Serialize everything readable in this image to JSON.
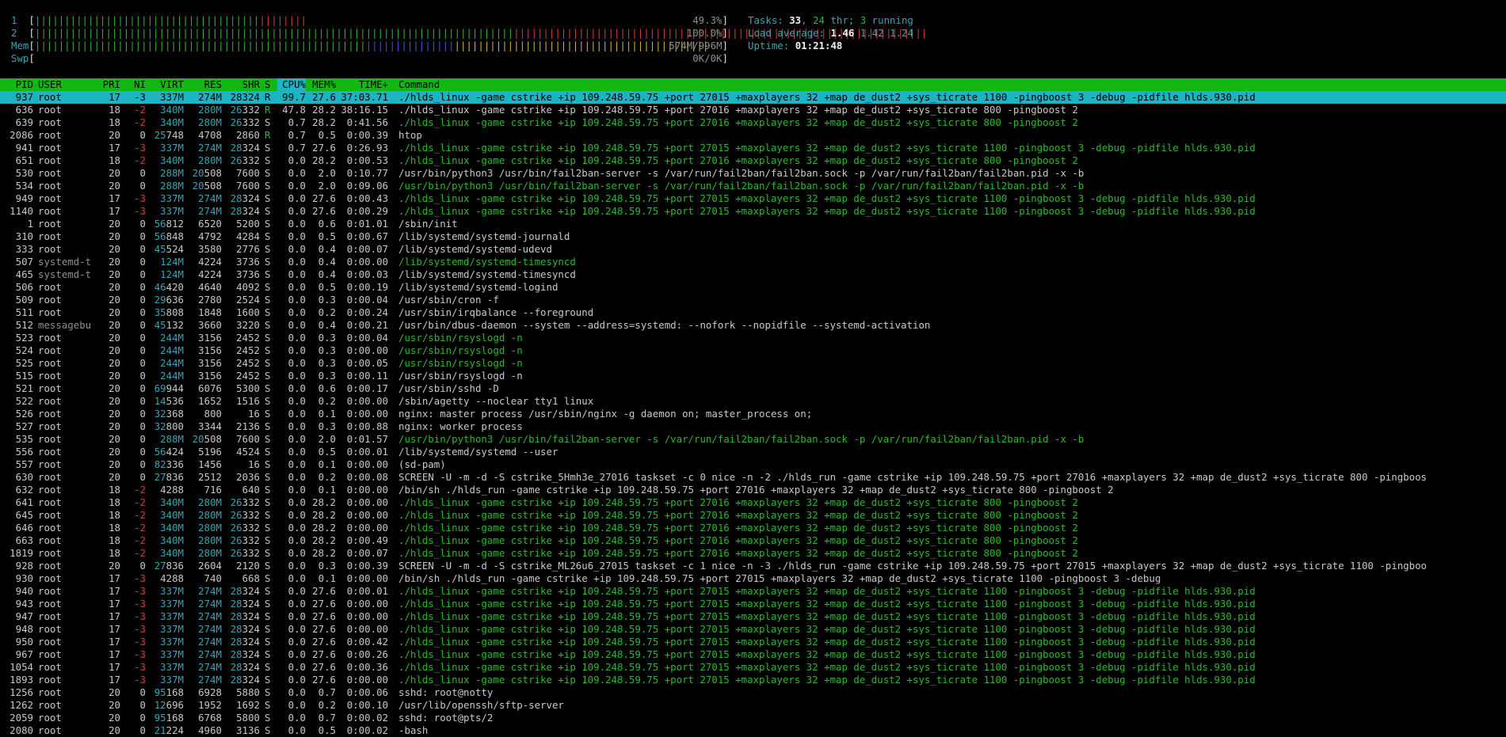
{
  "meters": [
    {
      "label": "1",
      "green": "||||||||||||||||||||||||||||||||||||||",
      "red": "||||||||",
      "blue": "",
      "yellow": "",
      "value": "49.3%"
    },
    {
      "label": "2",
      "green": "|||||||||||||||||||||||||||||||||||||||||||||||||||||||||||||||||||||||||||||||||",
      "red": "||||||||||||||||||||||||||||||||||||||||||||||||||||||||||||||||||||||",
      "blue": "",
      "yellow": "",
      "value": "100.0%"
    },
    {
      "label": "Mem",
      "green": "||||||||||||||||||||||||||||||||||||||||||||||||||||||||",
      "red": "",
      "blue": "|||||||||||||||",
      "yellow": "|||||||||||||||||||||||||||||||||||||||||||",
      "value": "574M/996M"
    },
    {
      "label": "Swp",
      "green": "",
      "red": "",
      "blue": "",
      "yellow": "",
      "value": "0K/0K"
    }
  ],
  "tasks": {
    "label": "Tasks: ",
    "total": "33",
    "sep": ", ",
    "thr": "24",
    "thr_label": " thr; ",
    "running": "3",
    "running_label": " running"
  },
  "load": {
    "label": "Load average: ",
    "l1": "1.46",
    "l5": "1.42",
    "l15": "1.24"
  },
  "uptime": {
    "label": "Uptime: ",
    "value": "01:21:48"
  },
  "columns": [
    "PID",
    "USER",
    "PRI",
    "NI",
    "VIRT",
    "RES",
    "SHR",
    "S",
    "CPU%",
    "MEM%",
    "TIME+",
    "Command"
  ],
  "rows": [
    {
      "pid": "937",
      "user": "root",
      "pri": "17",
      "ni": "-3",
      "virt": "337M",
      "res": "274M",
      "shr": "28324",
      "s": "R",
      "cpu": "99.7",
      "mem": "27.6",
      "time": "37:03.71",
      "cmd": "./hlds_linux -game cstrike +ip 109.248.59.75 +port 27015 +maxplayers 32 +map de_dust2 +sys_ticrate 1100 -pingboost 3 -debug -pidfile hlds.930.pid",
      "selected": true
    },
    {
      "pid": "636",
      "user": "root",
      "pri": "18",
      "ni": "-2",
      "virt": "340M",
      "res": "280M",
      "shr": "26332",
      "s": "R",
      "cpu": "47.8",
      "mem": "28.2",
      "time": "38:16.15",
      "cmd": "./hlds_linux -game cstrike +ip 109.248.59.75 +port 27016 +maxplayers 32 +map de_dust2 +sys_ticrate 800 -pingboost 2"
    },
    {
      "pid": "639",
      "user": "root",
      "pri": "18",
      "ni": "-2",
      "virt": "340M",
      "res": "280M",
      "shr": "26332",
      "s": "S",
      "cpu": "0.7",
      "mem": "28.2",
      "time": "0:41.56",
      "cmd": "./hlds_linux -game cstrike +ip 109.248.59.75 +port 27016 +maxplayers 32 +map de_dust2 +sys_ticrate 800 -pingboost 2",
      "thread": true
    },
    {
      "pid": "2086",
      "user": "root",
      "pri": "20",
      "ni": "0",
      "virt": "25748",
      "res": "4708",
      "shr": "2860",
      "s": "R",
      "cpu": "0.7",
      "mem": "0.5",
      "time": "0:00.39",
      "cmd": "htop"
    },
    {
      "pid": "941",
      "user": "root",
      "pri": "17",
      "ni": "-3",
      "virt": "337M",
      "res": "274M",
      "shr": "28324",
      "s": "S",
      "cpu": "0.7",
      "mem": "27.6",
      "time": "0:26.93",
      "cmd": "./hlds_linux -game cstrike +ip 109.248.59.75 +port 27015 +maxplayers 32 +map de_dust2 +sys_ticrate 1100 -pingboost 3 -debug -pidfile hlds.930.pid",
      "thread": true
    },
    {
      "pid": "651",
      "user": "root",
      "pri": "18",
      "ni": "-2",
      "virt": "340M",
      "res": "280M",
      "shr": "26332",
      "s": "S",
      "cpu": "0.0",
      "mem": "28.2",
      "time": "0:00.53",
      "cmd": "./hlds_linux -game cstrike +ip 109.248.59.75 +port 27016 +maxplayers 32 +map de_dust2 +sys_ticrate 800 -pingboost 2",
      "thread": true
    },
    {
      "pid": "530",
      "user": "root",
      "pri": "20",
      "ni": "0",
      "virt": "288M",
      "res": "20508",
      "shr": "7600",
      "s": "S",
      "cpu": "0.0",
      "mem": "2.0",
      "time": "0:10.77",
      "cmd": "/usr/bin/python3 /usr/bin/fail2ban-server -s /var/run/fail2ban/fail2ban.sock -p /var/run/fail2ban/fail2ban.pid -x -b"
    },
    {
      "pid": "534",
      "user": "root",
      "pri": "20",
      "ni": "0",
      "virt": "288M",
      "res": "20508",
      "shr": "7600",
      "s": "S",
      "cpu": "0.0",
      "mem": "2.0",
      "time": "0:09.06",
      "cmd": "/usr/bin/python3 /usr/bin/fail2ban-server -s /var/run/fail2ban/fail2ban.sock -p /var/run/fail2ban/fail2ban.pid -x -b",
      "thread": true
    },
    {
      "pid": "949",
      "user": "root",
      "pri": "17",
      "ni": "-3",
      "virt": "337M",
      "res": "274M",
      "shr": "28324",
      "s": "S",
      "cpu": "0.0",
      "mem": "27.6",
      "time": "0:00.43",
      "cmd": "./hlds_linux -game cstrike +ip 109.248.59.75 +port 27015 +maxplayers 32 +map de_dust2 +sys_ticrate 1100 -pingboost 3 -debug -pidfile hlds.930.pid",
      "thread": true
    },
    {
      "pid": "1140",
      "user": "root",
      "pri": "17",
      "ni": "-3",
      "virt": "337M",
      "res": "274M",
      "shr": "28324",
      "s": "S",
      "cpu": "0.0",
      "mem": "27.6",
      "time": "0:00.29",
      "cmd": "./hlds_linux -game cstrike +ip 109.248.59.75 +port 27015 +maxplayers 32 +map de_dust2 +sys_ticrate 1100 -pingboost 3 -debug -pidfile hlds.930.pid",
      "thread": true
    },
    {
      "pid": "1",
      "user": "root",
      "pri": "20",
      "ni": "0",
      "virt": "56812",
      "res": "6520",
      "shr": "5200",
      "s": "S",
      "cpu": "0.0",
      "mem": "0.6",
      "time": "0:01.01",
      "cmd": "/sbin/init"
    },
    {
      "pid": "310",
      "user": "root",
      "pri": "20",
      "ni": "0",
      "virt": "56848",
      "res": "4792",
      "shr": "4284",
      "s": "S",
      "cpu": "0.0",
      "mem": "0.5",
      "time": "0:00.67",
      "cmd": "/lib/systemd/systemd-journald"
    },
    {
      "pid": "333",
      "user": "root",
      "pri": "20",
      "ni": "0",
      "virt": "45524",
      "res": "3580",
      "shr": "2776",
      "s": "S",
      "cpu": "0.0",
      "mem": "0.4",
      "time": "0:00.07",
      "cmd": "/lib/systemd/systemd-udevd"
    },
    {
      "pid": "507",
      "user": "systemd-t",
      "pri": "20",
      "ni": "0",
      "virt": "124M",
      "res": "4224",
      "shr": "3736",
      "s": "S",
      "cpu": "0.0",
      "mem": "0.4",
      "time": "0:00.00",
      "cmd": "/lib/systemd/systemd-timesyncd",
      "thread": true,
      "dimuser": true
    },
    {
      "pid": "465",
      "user": "systemd-t",
      "pri": "20",
      "ni": "0",
      "virt": "124M",
      "res": "4224",
      "shr": "3736",
      "s": "S",
      "cpu": "0.0",
      "mem": "0.4",
      "time": "0:00.03",
      "cmd": "/lib/systemd/systemd-timesyncd",
      "dimuser": true
    },
    {
      "pid": "506",
      "user": "root",
      "pri": "20",
      "ni": "0",
      "virt": "46420",
      "res": "4640",
      "shr": "4092",
      "s": "S",
      "cpu": "0.0",
      "mem": "0.5",
      "time": "0:00.19",
      "cmd": "/lib/systemd/systemd-logind"
    },
    {
      "pid": "509",
      "user": "root",
      "pri": "20",
      "ni": "0",
      "virt": "29636",
      "res": "2780",
      "shr": "2524",
      "s": "S",
      "cpu": "0.0",
      "mem": "0.3",
      "time": "0:00.04",
      "cmd": "/usr/sbin/cron -f"
    },
    {
      "pid": "511",
      "user": "root",
      "pri": "20",
      "ni": "0",
      "virt": "35808",
      "res": "1848",
      "shr": "1600",
      "s": "S",
      "cpu": "0.0",
      "mem": "0.2",
      "time": "0:00.24",
      "cmd": "/usr/sbin/irqbalance --foreground"
    },
    {
      "pid": "512",
      "user": "messagebu",
      "pri": "20",
      "ni": "0",
      "virt": "45132",
      "res": "3660",
      "shr": "3220",
      "s": "S",
      "cpu": "0.0",
      "mem": "0.4",
      "time": "0:00.21",
      "cmd": "/usr/bin/dbus-daemon --system --address=systemd: --nofork --nopidfile --systemd-activation",
      "dimuser": true
    },
    {
      "pid": "523",
      "user": "root",
      "pri": "20",
      "ni": "0",
      "virt": "244M",
      "res": "3156",
      "shr": "2452",
      "s": "S",
      "cpu": "0.0",
      "mem": "0.3",
      "time": "0:00.04",
      "cmd": "/usr/sbin/rsyslogd -n",
      "thread": true
    },
    {
      "pid": "524",
      "user": "root",
      "pri": "20",
      "ni": "0",
      "virt": "244M",
      "res": "3156",
      "shr": "2452",
      "s": "S",
      "cpu": "0.0",
      "mem": "0.3",
      "time": "0:00.00",
      "cmd": "/usr/sbin/rsyslogd -n",
      "thread": true
    },
    {
      "pid": "525",
      "user": "root",
      "pri": "20",
      "ni": "0",
      "virt": "244M",
      "res": "3156",
      "shr": "2452",
      "s": "S",
      "cpu": "0.0",
      "mem": "0.3",
      "time": "0:00.05",
      "cmd": "/usr/sbin/rsyslogd -n",
      "thread": true
    },
    {
      "pid": "515",
      "user": "root",
      "pri": "20",
      "ni": "0",
      "virt": "244M",
      "res": "3156",
      "shr": "2452",
      "s": "S",
      "cpu": "0.0",
      "mem": "0.3",
      "time": "0:00.11",
      "cmd": "/usr/sbin/rsyslogd -n"
    },
    {
      "pid": "521",
      "user": "root",
      "pri": "20",
      "ni": "0",
      "virt": "69944",
      "res": "6076",
      "shr": "5300",
      "s": "S",
      "cpu": "0.0",
      "mem": "0.6",
      "time": "0:00.17",
      "cmd": "/usr/sbin/sshd -D"
    },
    {
      "pid": "522",
      "user": "root",
      "pri": "20",
      "ni": "0",
      "virt": "14536",
      "res": "1652",
      "shr": "1516",
      "s": "S",
      "cpu": "0.0",
      "mem": "0.2",
      "time": "0:00.00",
      "cmd": "/sbin/agetty --noclear tty1 linux"
    },
    {
      "pid": "526",
      "user": "root",
      "pri": "20",
      "ni": "0",
      "virt": "32368",
      "res": "800",
      "shr": "16",
      "s": "S",
      "cpu": "0.0",
      "mem": "0.1",
      "time": "0:00.00",
      "cmd": "nginx: master process /usr/sbin/nginx -g daemon on; master_process on;"
    },
    {
      "pid": "527",
      "user": "root",
      "pri": "20",
      "ni": "0",
      "virt": "32800",
      "res": "3344",
      "shr": "2136",
      "s": "S",
      "cpu": "0.0",
      "mem": "0.3",
      "time": "0:00.88",
      "cmd": "nginx: worker process"
    },
    {
      "pid": "535",
      "user": "root",
      "pri": "20",
      "ni": "0",
      "virt": "288M",
      "res": "20508",
      "shr": "7600",
      "s": "S",
      "cpu": "0.0",
      "mem": "2.0",
      "time": "0:01.57",
      "cmd": "/usr/bin/python3 /usr/bin/fail2ban-server -s /var/run/fail2ban/fail2ban.sock -p /var/run/fail2ban/fail2ban.pid -x -b",
      "thread": true
    },
    {
      "pid": "556",
      "user": "root",
      "pri": "20",
      "ni": "0",
      "virt": "56424",
      "res": "5196",
      "shr": "4524",
      "s": "S",
      "cpu": "0.0",
      "mem": "0.5",
      "time": "0:00.01",
      "cmd": "/lib/systemd/systemd --user"
    },
    {
      "pid": "557",
      "user": "root",
      "pri": "20",
      "ni": "0",
      "virt": "82336",
      "res": "1456",
      "shr": "16",
      "s": "S",
      "cpu": "0.0",
      "mem": "0.1",
      "time": "0:00.00",
      "cmd": "(sd-pam)"
    },
    {
      "pid": "630",
      "user": "root",
      "pri": "20",
      "ni": "0",
      "virt": "27836",
      "res": "2512",
      "shr": "2036",
      "s": "S",
      "cpu": "0.0",
      "mem": "0.2",
      "time": "0:00.08",
      "cmd": "SCREEN -U -m -d -S cstrike_5Hmh3e_27016 taskset -c 0 nice -n -2 ./hlds_run -game cstrike +ip 109.248.59.75 +port 27016 +maxplayers 32 +map de_dust2 +sys_ticrate 800 -pingboos"
    },
    {
      "pid": "632",
      "user": "root",
      "pri": "18",
      "ni": "-2",
      "virt": "4288",
      "res": "716",
      "shr": "640",
      "s": "S",
      "cpu": "0.0",
      "mem": "0.1",
      "time": "0:00.00",
      "cmd": "/bin/sh ./hlds_run -game cstrike +ip 109.248.59.75 +port 27016 +maxplayers 32 +map de_dust2 +sys_ticrate 800 -pingboost 2"
    },
    {
      "pid": "641",
      "user": "root",
      "pri": "18",
      "ni": "-2",
      "virt": "340M",
      "res": "280M",
      "shr": "26332",
      "s": "S",
      "cpu": "0.0",
      "mem": "28.2",
      "time": "0:00.00",
      "cmd": "./hlds_linux -game cstrike +ip 109.248.59.75 +port 27016 +maxplayers 32 +map de_dust2 +sys_ticrate 800 -pingboost 2",
      "thread": true
    },
    {
      "pid": "645",
      "user": "root",
      "pri": "18",
      "ni": "-2",
      "virt": "340M",
      "res": "280M",
      "shr": "26332",
      "s": "S",
      "cpu": "0.0",
      "mem": "28.2",
      "time": "0:00.00",
      "cmd": "./hlds_linux -game cstrike +ip 109.248.59.75 +port 27016 +maxplayers 32 +map de_dust2 +sys_ticrate 800 -pingboost 2",
      "thread": true
    },
    {
      "pid": "646",
      "user": "root",
      "pri": "18",
      "ni": "-2",
      "virt": "340M",
      "res": "280M",
      "shr": "26332",
      "s": "S",
      "cpu": "0.0",
      "mem": "28.2",
      "time": "0:00.00",
      "cmd": "./hlds_linux -game cstrike +ip 109.248.59.75 +port 27016 +maxplayers 32 +map de_dust2 +sys_ticrate 800 -pingboost 2",
      "thread": true
    },
    {
      "pid": "663",
      "user": "root",
      "pri": "18",
      "ni": "-2",
      "virt": "340M",
      "res": "280M",
      "shr": "26332",
      "s": "S",
      "cpu": "0.0",
      "mem": "28.2",
      "time": "0:00.49",
      "cmd": "./hlds_linux -game cstrike +ip 109.248.59.75 +port 27016 +maxplayers 32 +map de_dust2 +sys_ticrate 800 -pingboost 2",
      "thread": true
    },
    {
      "pid": "1819",
      "user": "root",
      "pri": "18",
      "ni": "-2",
      "virt": "340M",
      "res": "280M",
      "shr": "26332",
      "s": "S",
      "cpu": "0.0",
      "mem": "28.2",
      "time": "0:00.07",
      "cmd": "./hlds_linux -game cstrike +ip 109.248.59.75 +port 27016 +maxplayers 32 +map de_dust2 +sys_ticrate 800 -pingboost 2",
      "thread": true
    },
    {
      "pid": "928",
      "user": "root",
      "pri": "20",
      "ni": "0",
      "virt": "27836",
      "res": "2604",
      "shr": "2120",
      "s": "S",
      "cpu": "0.0",
      "mem": "0.3",
      "time": "0:00.39",
      "cmd": "SCREEN -U -m -d -S cstrike_ML26u6_27015 taskset -c 1 nice -n -3 ./hlds_run -game cstrike +ip 109.248.59.75 +port 27015 +maxplayers 32 +map de_dust2 +sys_ticrate 1100 -pingboo"
    },
    {
      "pid": "930",
      "user": "root",
      "pri": "17",
      "ni": "-3",
      "virt": "4288",
      "res": "740",
      "shr": "668",
      "s": "S",
      "cpu": "0.0",
      "mem": "0.1",
      "time": "0:00.00",
      "cmd": "/bin/sh ./hlds_run -game cstrike +ip 109.248.59.75 +port 27015 +maxplayers 32 +map de_dust2 +sys_ticrate 1100 -pingboost 3 -debug"
    },
    {
      "pid": "940",
      "user": "root",
      "pri": "17",
      "ni": "-3",
      "virt": "337M",
      "res": "274M",
      "shr": "28324",
      "s": "S",
      "cpu": "0.0",
      "mem": "27.6",
      "time": "0:00.01",
      "cmd": "./hlds_linux -game cstrike +ip 109.248.59.75 +port 27015 +maxplayers 32 +map de_dust2 +sys_ticrate 1100 -pingboost 3 -debug -pidfile hlds.930.pid",
      "thread": true
    },
    {
      "pid": "943",
      "user": "root",
      "pri": "17",
      "ni": "-3",
      "virt": "337M",
      "res": "274M",
      "shr": "28324",
      "s": "S",
      "cpu": "0.0",
      "mem": "27.6",
      "time": "0:00.00",
      "cmd": "./hlds_linux -game cstrike +ip 109.248.59.75 +port 27015 +maxplayers 32 +map de_dust2 +sys_ticrate 1100 -pingboost 3 -debug -pidfile hlds.930.pid",
      "thread": true
    },
    {
      "pid": "947",
      "user": "root",
      "pri": "17",
      "ni": "-3",
      "virt": "337M",
      "res": "274M",
      "shr": "28324",
      "s": "S",
      "cpu": "0.0",
      "mem": "27.6",
      "time": "0:00.00",
      "cmd": "./hlds_linux -game cstrike +ip 109.248.59.75 +port 27015 +maxplayers 32 +map de_dust2 +sys_ticrate 1100 -pingboost 3 -debug -pidfile hlds.930.pid",
      "thread": true
    },
    {
      "pid": "948",
      "user": "root",
      "pri": "17",
      "ni": "-3",
      "virt": "337M",
      "res": "274M",
      "shr": "28324",
      "s": "S",
      "cpu": "0.0",
      "mem": "27.6",
      "time": "0:00.00",
      "cmd": "./hlds_linux -game cstrike +ip 109.248.59.75 +port 27015 +maxplayers 32 +map de_dust2 +sys_ticrate 1100 -pingboost 3 -debug -pidfile hlds.930.pid",
      "thread": true
    },
    {
      "pid": "950",
      "user": "root",
      "pri": "17",
      "ni": "-3",
      "virt": "337M",
      "res": "274M",
      "shr": "28324",
      "s": "S",
      "cpu": "0.0",
      "mem": "27.6",
      "time": "0:00.42",
      "cmd": "./hlds_linux -game cstrike +ip 109.248.59.75 +port 27015 +maxplayers 32 +map de_dust2 +sys_ticrate 1100 -pingboost 3 -debug -pidfile hlds.930.pid",
      "thread": true
    },
    {
      "pid": "967",
      "user": "root",
      "pri": "17",
      "ni": "-3",
      "virt": "337M",
      "res": "274M",
      "shr": "28324",
      "s": "S",
      "cpu": "0.0",
      "mem": "27.6",
      "time": "0:00.26",
      "cmd": "./hlds_linux -game cstrike +ip 109.248.59.75 +port 27015 +maxplayers 32 +map de_dust2 +sys_ticrate 1100 -pingboost 3 -debug -pidfile hlds.930.pid",
      "thread": true
    },
    {
      "pid": "1054",
      "user": "root",
      "pri": "17",
      "ni": "-3",
      "virt": "337M",
      "res": "274M",
      "shr": "28324",
      "s": "S",
      "cpu": "0.0",
      "mem": "27.6",
      "time": "0:00.36",
      "cmd": "./hlds_linux -game cstrike +ip 109.248.59.75 +port 27015 +maxplayers 32 +map de_dust2 +sys_ticrate 1100 -pingboost 3 -debug -pidfile hlds.930.pid",
      "thread": true
    },
    {
      "pid": "1893",
      "user": "root",
      "pri": "17",
      "ni": "-3",
      "virt": "337M",
      "res": "274M",
      "shr": "28324",
      "s": "S",
      "cpu": "0.0",
      "mem": "27.6",
      "time": "0:00.00",
      "cmd": "./hlds_linux -game cstrike +ip 109.248.59.75 +port 27015 +maxplayers 32 +map de_dust2 +sys_ticrate 1100 -pingboost 3 -debug -pidfile hlds.930.pid",
      "thread": true
    },
    {
      "pid": "1256",
      "user": "root",
      "pri": "20",
      "ni": "0",
      "virt": "95168",
      "res": "6928",
      "shr": "5880",
      "s": "S",
      "cpu": "0.0",
      "mem": "0.7",
      "time": "0:00.06",
      "cmd": "sshd: root@notty"
    },
    {
      "pid": "1262",
      "user": "root",
      "pri": "20",
      "ni": "0",
      "virt": "12696",
      "res": "1952",
      "shr": "1692",
      "s": "S",
      "cpu": "0.0",
      "mem": "0.2",
      "time": "0:00.10",
      "cmd": "/usr/lib/openssh/sftp-server"
    },
    {
      "pid": "2059",
      "user": "root",
      "pri": "20",
      "ni": "0",
      "virt": "95168",
      "res": "6768",
      "shr": "5800",
      "s": "S",
      "cpu": "0.0",
      "mem": "0.7",
      "time": "0:00.02",
      "cmd": "sshd: root@pts/2"
    },
    {
      "pid": "2080",
      "user": "root",
      "pri": "20",
      "ni": "0",
      "virt": "21224",
      "res": "4960",
      "shr": "3136",
      "s": "S",
      "cpu": "0.0",
      "mem": "0.5",
      "time": "0:00.02",
      "cmd": "-bash"
    }
  ]
}
